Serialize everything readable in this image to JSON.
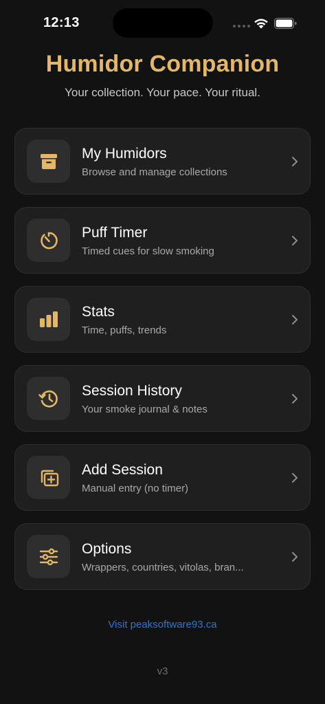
{
  "status_bar": {
    "time": "12:13"
  },
  "header": {
    "title": "Humidor Companion",
    "subtitle": "Your collection. Your pace. Your ritual."
  },
  "colors": {
    "accent": "#e2b765",
    "background": "#121212",
    "card": "#1f1f1f",
    "link": "#2f76c6"
  },
  "menu": {
    "items": [
      {
        "title": "My Humidors",
        "subtitle": "Browse and manage collections",
        "icon": "archive-box-icon"
      },
      {
        "title": "Puff Timer",
        "subtitle": "Timed cues for slow smoking",
        "icon": "timer-icon"
      },
      {
        "title": "Stats",
        "subtitle": "Time, puffs, trends",
        "icon": "bar-chart-icon"
      },
      {
        "title": "Session History",
        "subtitle": "Your smoke journal & notes",
        "icon": "history-clock-icon"
      },
      {
        "title": "Add Session",
        "subtitle": "Manual entry (no timer)",
        "icon": "add-stack-icon"
      },
      {
        "title": "Options",
        "subtitle": "Wrappers, countries, vitolas, bran...",
        "icon": "sliders-icon"
      }
    ]
  },
  "footer": {
    "link": "Visit peaksoftware93.ca",
    "version": "v3"
  }
}
